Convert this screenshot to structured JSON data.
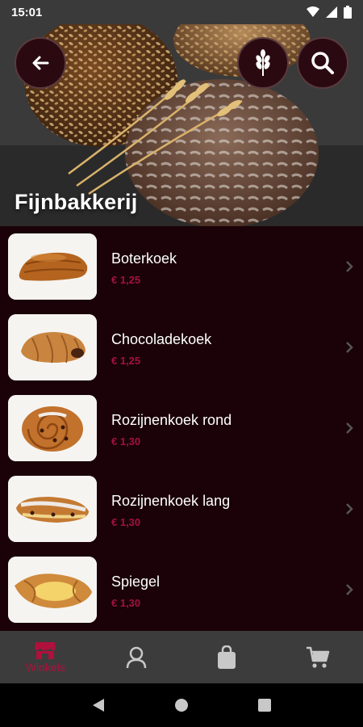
{
  "status_bar": {
    "time": "15:01",
    "icons": [
      "wifi-icon",
      "signal-icon",
      "battery-icon"
    ]
  },
  "header": {
    "title": "Fijnbakkerij",
    "buttons": [
      "back-arrow-icon",
      "wheat-icon",
      "search-icon"
    ]
  },
  "products": [
    {
      "name": "Boterkoek",
      "price": "€ 1,25"
    },
    {
      "name": "Chocoladekoek",
      "price": "€ 1,25"
    },
    {
      "name": "Rozijnenkoek rond",
      "price": "€ 1,30"
    },
    {
      "name": "Rozijnenkoek lang",
      "price": "€ 1,30"
    },
    {
      "name": "Spiegel",
      "price": "€ 1,30"
    }
  ],
  "bottom_nav": {
    "items": [
      {
        "label": "Winkels",
        "icon": "store-icon",
        "active": true
      },
      {
        "icon": "user-icon"
      },
      {
        "icon": "bag-icon"
      },
      {
        "icon": "cart-icon"
      }
    ]
  },
  "colors": {
    "background": "#1a0208",
    "accent": "#a4123f",
    "nav_bar": "#3c3c3c"
  }
}
